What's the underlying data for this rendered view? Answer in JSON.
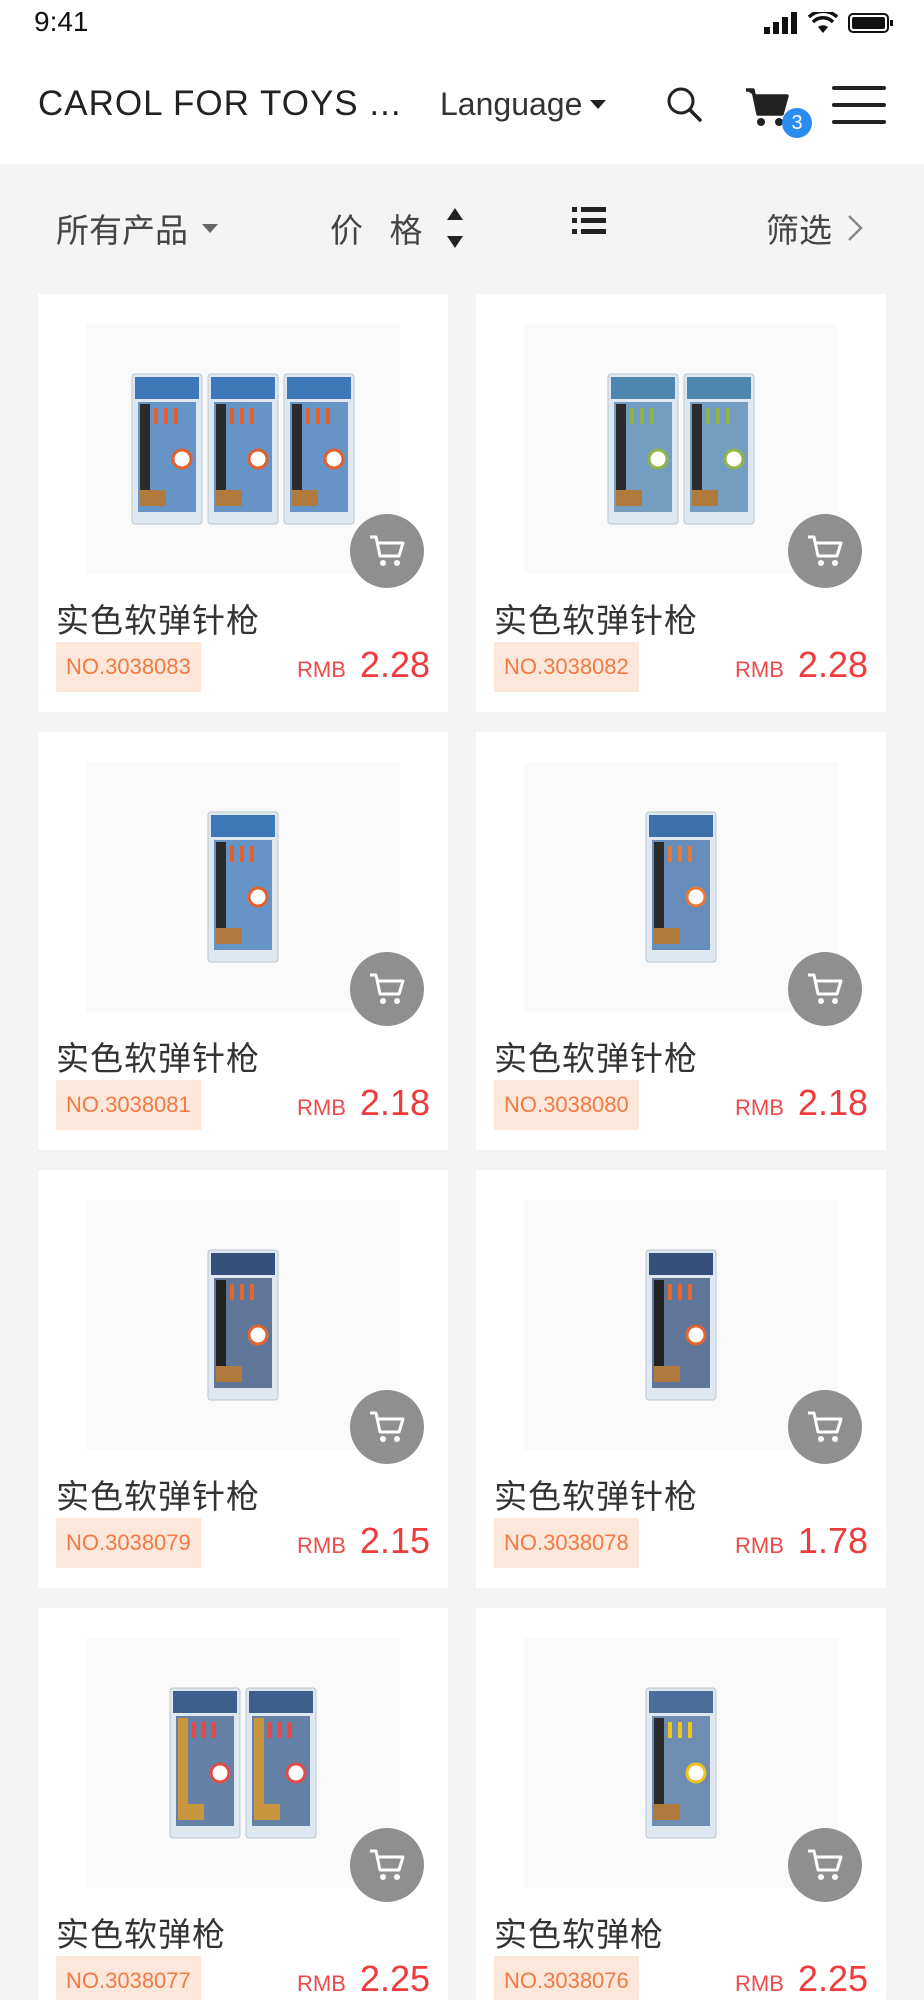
{
  "status": {
    "time": "9:41"
  },
  "header": {
    "brand": "CAROL FOR TOYS ...",
    "language": "Language",
    "cart_count": "3"
  },
  "filters": {
    "all_products": "所有产品",
    "price": "价 格",
    "filter": "筛选"
  },
  "products": [
    {
      "title": "实色软弹针枪",
      "no": "NO.3038083",
      "currency": "RMB",
      "price": "2.28",
      "packs": 3,
      "variant": "blue"
    },
    {
      "title": "实色软弹针枪",
      "no": "NO.3038082",
      "currency": "RMB",
      "price": "2.28",
      "packs": 2,
      "variant": "green"
    },
    {
      "title": "实色软弹针枪",
      "no": "NO.3038081",
      "currency": "RMB",
      "price": "2.18",
      "packs": 1,
      "variant": "blue"
    },
    {
      "title": "实色软弹针枪",
      "no": "NO.3038080",
      "currency": "RMB",
      "price": "2.18",
      "packs": 1,
      "variant": "orange"
    },
    {
      "title": "实色软弹针枪",
      "no": "NO.3038079",
      "currency": "RMB",
      "price": "2.15",
      "packs": 1,
      "variant": "dark"
    },
    {
      "title": "实色软弹针枪",
      "no": "NO.3038078",
      "currency": "RMB",
      "price": "1.78",
      "packs": 1,
      "variant": "dark"
    },
    {
      "title": "实色软弹枪",
      "no": "NO.3038077",
      "currency": "RMB",
      "price": "2.25",
      "packs": 2,
      "variant": "gold"
    },
    {
      "title": "实色软弹枪",
      "no": "NO.3038076",
      "currency": "RMB",
      "price": "2.25",
      "packs": 1,
      "variant": "yellow"
    }
  ]
}
